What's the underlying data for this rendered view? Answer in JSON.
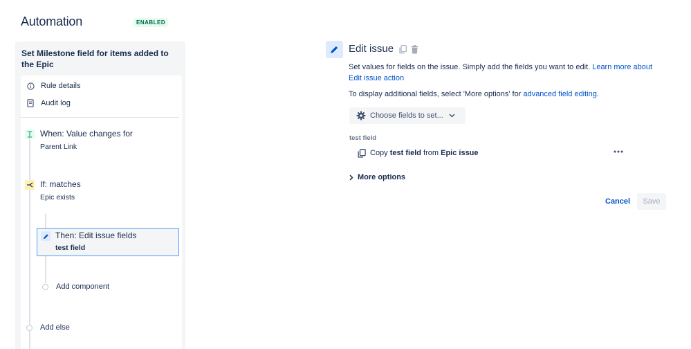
{
  "header": {
    "title": "Automation",
    "status_badge": "ENABLED"
  },
  "rule": {
    "name": "Set Milestone field for items added to the Epic",
    "nav": [
      {
        "label": "Rule details",
        "icon": "info-icon"
      },
      {
        "label": "Audit log",
        "icon": "document-icon"
      }
    ],
    "trigger": {
      "title": "When: Value changes for",
      "subtitle": "Parent Link",
      "icon": "field-change-icon",
      "color": "#36b37e"
    },
    "condition": {
      "title": "If: matches",
      "subtitle": "Epic exists",
      "icon": "branch-icon",
      "color": "#ffab00"
    },
    "action": {
      "title": "Then: Edit issue fields",
      "subtitle": "test field",
      "icon": "pencil-icon",
      "color": "#0052cc"
    },
    "add_component": "Add component",
    "add_else": "Add else"
  },
  "detail": {
    "title": "Edit issue",
    "copy_icon": "copy-icon",
    "delete_icon": "trash-icon",
    "description": "Set values for fields on the issue. Simply add the fields you want to edit.",
    "learn_more_link": "Learn more about Edit issue action",
    "advanced_prefix": "To display additional fields, select 'More options' for",
    "advanced_link": "advanced field editing",
    "advanced_suffix": ".",
    "choose_fields_label": "Choose fields to set...",
    "field_label": "test field",
    "field_row": {
      "prefix": "Copy",
      "field": "test field",
      "middle": "from",
      "source": "Epic issue"
    },
    "more_options": "More options",
    "cancel": "Cancel",
    "save": "Save"
  },
  "colors": {
    "accent": "#0052cc",
    "selected_border": "#4c9aff",
    "enabled_bg": "#e3fcef",
    "enabled_text": "#006644"
  }
}
